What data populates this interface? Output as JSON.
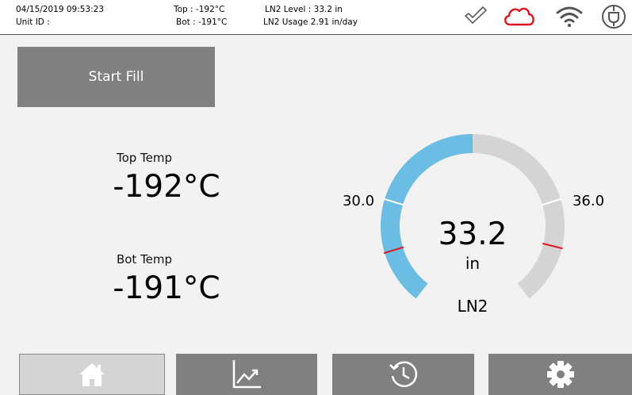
{
  "status": {
    "datetime": "04/15/2019 09:53:23",
    "unit_id": "Unit ID :",
    "top": "Top : -192°C",
    "bot": "Bot : -191°C",
    "ln2_level": "LN2 Level : 33.2 in",
    "ln2_usage": "LN2 Usage  2.91 in/day",
    "icons": [
      "checkmark-icon",
      "cloud-icon",
      "wifi-icon",
      "power-plug-icon"
    ],
    "cloud_color": "#d9161c"
  },
  "actions": {
    "start_fill": "Start Fill"
  },
  "temps": {
    "top_label": "Top Temp",
    "top_value": "-192°C",
    "bot_label": "Bot Temp",
    "bot_value": "-191°C"
  },
  "gauge": {
    "value": "33.2",
    "unit": "in",
    "label": "LN2",
    "low_mark": "30.0",
    "high_mark": "36.0",
    "fill_fraction": 0.5,
    "fill_color": "#6bbde3",
    "track_color": "#d4d4d4",
    "alarm_color": "#e0141a"
  },
  "nav": [
    {
      "name": "home",
      "icon": "home-icon"
    },
    {
      "name": "chart",
      "icon": "chart-icon"
    },
    {
      "name": "history",
      "icon": "history-icon"
    },
    {
      "name": "settings",
      "icon": "gear-icon"
    }
  ]
}
